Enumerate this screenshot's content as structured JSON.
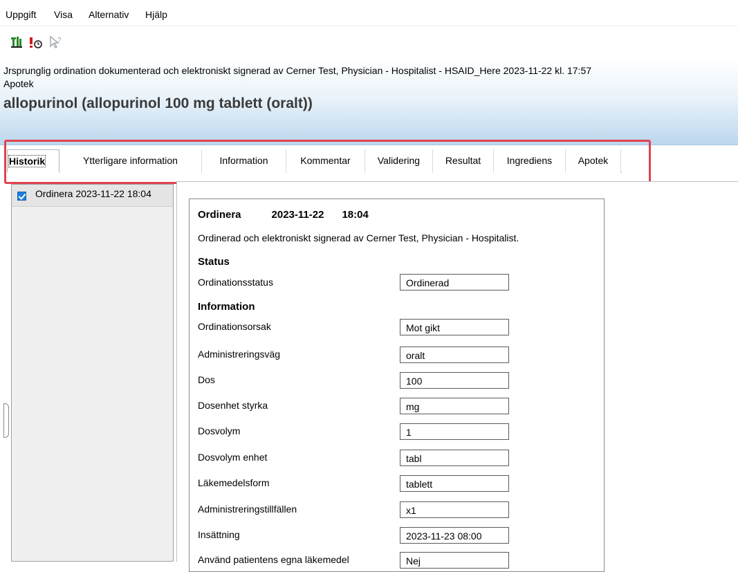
{
  "menu": [
    "Uppgift",
    "Visa",
    "Alternativ",
    "Hjälp"
  ],
  "toolbar": {
    "icons": [
      "sign-order-icon",
      "alert-clock-icon",
      "help-pointer-icon"
    ],
    "colors": {
      "sign": "#2b8a2b",
      "alert": "#d21b1b",
      "help": "#9aa0a6"
    }
  },
  "header": {
    "line1": "Jrsprunglig ordination dokumenterad och elektroniskt signerad av Cerner Test, Physician - Hospitalist - HSAID_Here 2023-11-22 kl. 17:57",
    "line2": "Apotek",
    "title": "allopurinol (allopurinol 100 mg tablett (oralt))"
  },
  "tabs": [
    {
      "label": "Historik",
      "active": true
    },
    {
      "label": "Ytterligare information"
    },
    {
      "label": "Information"
    },
    {
      "label": "Kommentar"
    },
    {
      "label": "Validering"
    },
    {
      "label": "Resultat"
    },
    {
      "label": "Ingrediens"
    },
    {
      "label": "Apotek"
    }
  ],
  "history_list": [
    {
      "label": "Ordinera 2023-11-22 18:04",
      "checked": true
    }
  ],
  "detail": {
    "action": "Ordinera",
    "date": "2023-11-22",
    "time": "18:04",
    "signed_text": "Ordinerad och elektroniskt signerad av Cerner Test, Physician - Hospitalist.",
    "status_heading": "Status",
    "status_fields": [
      {
        "label": "Ordinationsstatus",
        "value": "Ordinerad"
      }
    ],
    "info_heading": "Information",
    "info_fields": [
      {
        "label": "Ordinationsorsak",
        "value": "Mot gikt"
      },
      {
        "label": "Administreringsväg",
        "value": "oralt"
      },
      {
        "label": "Dos",
        "value": "100"
      },
      {
        "label": "Dosenhet styrka",
        "value": "mg"
      },
      {
        "label": "Dosvolym",
        "value": "1"
      },
      {
        "label": "Dosvolym enhet",
        "value": "tabl"
      },
      {
        "label": "Läkemedelsform",
        "value": "tablett"
      },
      {
        "label": "Administreringstillfällen",
        "value": "x1"
      },
      {
        "label": "Insättning",
        "value": "2023-11-23 08:00"
      },
      {
        "label": "Använd patientens egna läkemedel",
        "value": "Nej"
      }
    ]
  },
  "highlight_color": "#e0434f"
}
